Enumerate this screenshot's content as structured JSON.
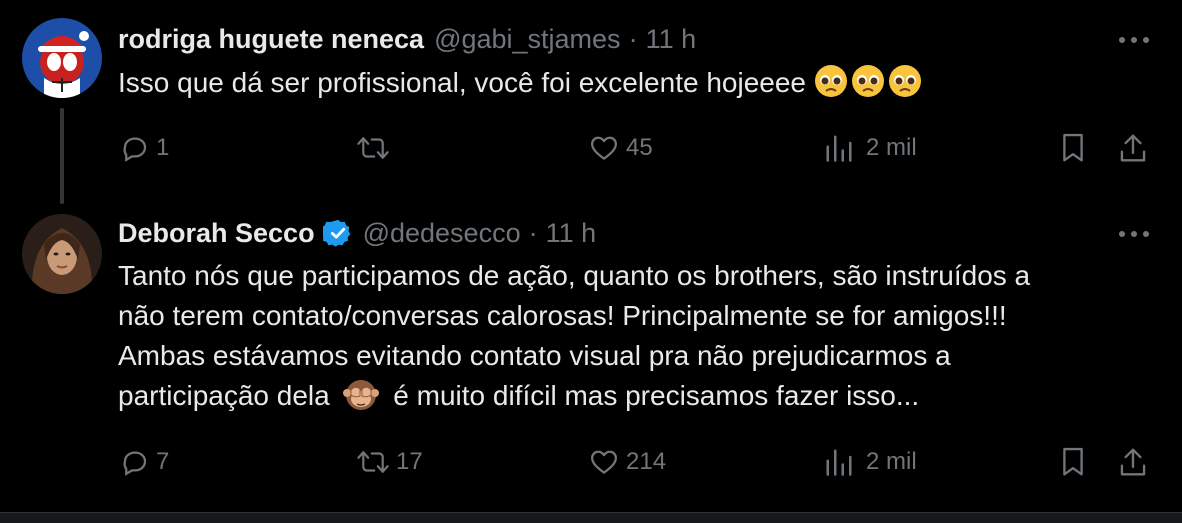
{
  "tweets": [
    {
      "name": "rodriga huguete neneca",
      "handle": "@gabi_stjames",
      "dot": "·",
      "time": "11 h",
      "text": "Isso que dá ser profissional, você foi excelente hojeeee",
      "reply_count": "1",
      "retweet_count": "",
      "like_count": "45",
      "view_count": "2 mil"
    },
    {
      "name": "Deborah Secco",
      "handle": "@dedesecco",
      "dot": "·",
      "time": "11 h",
      "text_lines": [
        "Tanto nós que participamos de ação, quanto os brothers, são instruídos a",
        "não terem contato/conversas calorosas! Principalmente se for amigos!!!",
        "Ambas estávamos evitando contato visual pra não prejudicarmos a",
        "participação dela",
        "é muito difícil mas precisamos fazer isso..."
      ],
      "reply_count": "7",
      "retweet_count": "17",
      "like_count": "214",
      "view_count": "2 mil"
    }
  ],
  "icons": {
    "reply": "reply-icon",
    "retweet": "retweet-icon",
    "like": "heart-icon",
    "views": "views-icon",
    "bookmark": "bookmark-icon",
    "share": "share-icon",
    "more": "more-icon",
    "verified": "verified-badge-icon",
    "emoji_pleading": "pleading-face-emoji",
    "emoji_monkey": "see-no-evil-monkey-emoji"
  },
  "colors": {
    "background": "#000000",
    "text_primary": "#e7e9ea",
    "text_secondary": "#71767b",
    "verified_blue": "#1d9bf0",
    "thread_line": "#333639"
  }
}
